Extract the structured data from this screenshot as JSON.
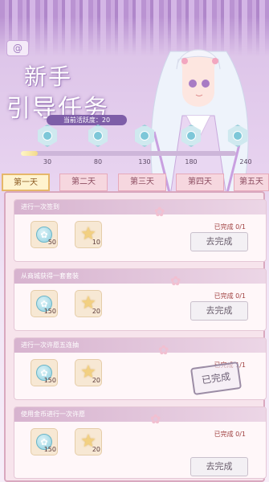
{
  "header": {
    "back_icon": "swirl-icon",
    "title_line1": "新手",
    "title_line2": "引导任务",
    "activity_label": "当前活跃度：20"
  },
  "milestones": {
    "values": [
      "30",
      "80",
      "130",
      "180",
      "240"
    ],
    "progress_fraction": 0.08
  },
  "tabs": [
    "第一天",
    "第二天",
    "第三天",
    "第四天",
    "第五天"
  ],
  "active_tab": 0,
  "tasks": [
    {
      "title": "进行一次签到",
      "rewards": [
        "50",
        "10"
      ],
      "progress": "已完成 0/1",
      "button": "去完成",
      "done": false
    },
    {
      "title": "从商城获得一套套装",
      "rewards": [
        "150",
        "20"
      ],
      "progress": "已完成 0/1",
      "button": "去完成",
      "done": false
    },
    {
      "title": "进行一次许愿五连抽",
      "rewards": [
        "150",
        "20"
      ],
      "progress": "已完成 1/1",
      "button": "已完成",
      "done": true
    },
    {
      "title": "使用金币进行一次许愿",
      "rewards": [
        "150",
        "20"
      ],
      "progress": "已完成 0/1",
      "button": "去完成",
      "done": false
    }
  ],
  "colors": {
    "accent": "#e6b76a",
    "panel": "#f7e4ec",
    "progress": "#a04040"
  }
}
